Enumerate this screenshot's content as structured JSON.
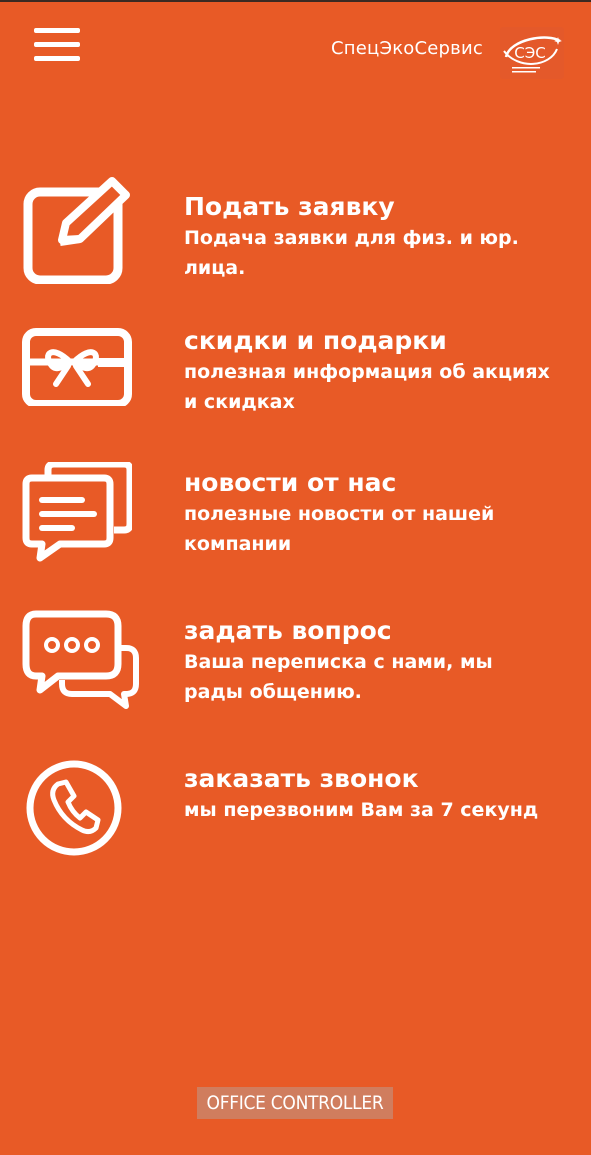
{
  "header": {
    "brand_name": "СпецЭкоСервис",
    "logo_text": "СЭС"
  },
  "menu": {
    "items": [
      {
        "title": "Подать заявку",
        "description": "Подача заявки для физ. и юр. лица.",
        "icon": "edit-form-icon"
      },
      {
        "title": "скидки и подарки",
        "description": "полезная информация об акциях и скидках",
        "icon": "gift-card-icon"
      },
      {
        "title": "новости от нас",
        "description": "полезные новости от нашей компании",
        "icon": "news-messages-icon"
      },
      {
        "title": "задать вопрос",
        "description": "Ваша переписка с нами, мы рады общению.",
        "icon": "chat-bubbles-icon"
      },
      {
        "title": "заказать звонок",
        "description": "мы перезвоним Вам за 7 секунд",
        "icon": "phone-call-icon"
      }
    ]
  },
  "footer": {
    "badge_text": "OFFICE CONTROLLER"
  },
  "colors": {
    "background": "#e85a26",
    "foreground": "#ffffff",
    "badge_background": "#d07d5e"
  }
}
